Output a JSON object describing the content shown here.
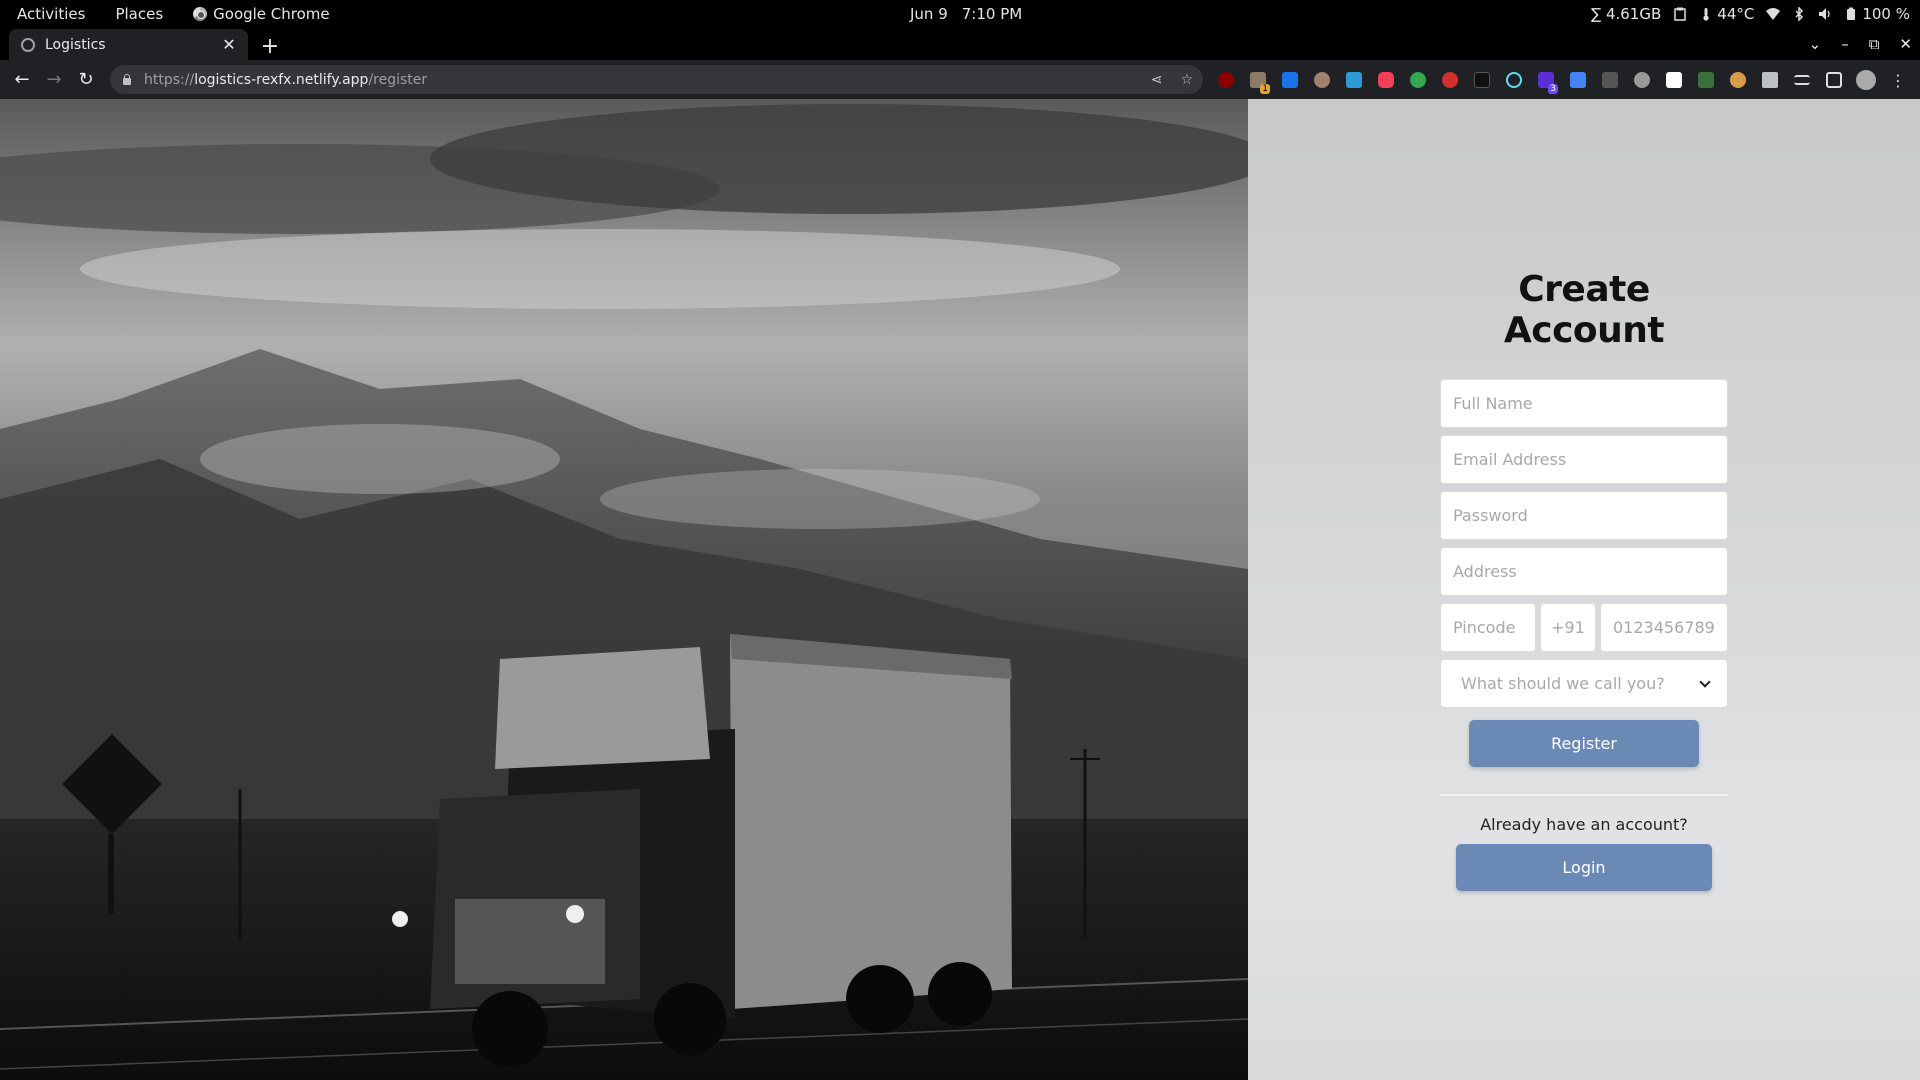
{
  "system_bar": {
    "activities": "Activities",
    "places": "Places",
    "app_name": "Google Chrome",
    "date": "Jun 9",
    "time": "7:10 PM",
    "memory": "∑ 4.61GB",
    "temperature": "44°C",
    "battery": "100 %"
  },
  "browser": {
    "tab_title": "Logistics",
    "url_scheme": "https://",
    "url_host": "logistics-rexfx.netlify.app",
    "url_path": "/register",
    "extension_badges": [
      "1",
      "3"
    ]
  },
  "form": {
    "heading": "Create Account",
    "full_name_placeholder": "Full Name",
    "email_placeholder": "Email Address",
    "password_placeholder": "Password",
    "address_placeholder": "Address",
    "pincode_placeholder": "Pincode",
    "country_code": "+91",
    "phone_placeholder": "0123456789",
    "role_select": "What should we call you?",
    "register_label": "Register",
    "already_text": "Already have an account?",
    "login_label": "Login"
  },
  "colors": {
    "button": "#6b89b5",
    "panel_bg": "#d6d7d9",
    "chrome_toolbar": "#202124"
  }
}
